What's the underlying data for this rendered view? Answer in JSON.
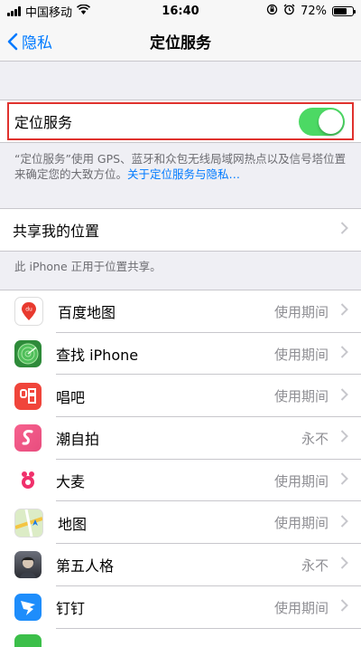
{
  "status": {
    "carrier": "中国移动",
    "time": "16:40",
    "battery": "72%",
    "battery_level": 0.72
  },
  "nav": {
    "back_label": "隐私",
    "title": "定位服务"
  },
  "location_toggle": {
    "label": "定位服务",
    "on": true
  },
  "footer": {
    "text": "“定位服务”使用 GPS、蓝牙和众包无线局域网热点以及信号塔位置来确定您的大致方位。",
    "link": "关于定位服务与隐私…"
  },
  "share": {
    "label": "共享我的位置",
    "note": "此 iPhone 正用于位置共享。"
  },
  "apps": [
    {
      "name": "百度地图",
      "value": "使用期间",
      "icon": "baidu-maps-icon"
    },
    {
      "name": "查找 iPhone",
      "value": "使用期间",
      "icon": "find-iphone-icon"
    },
    {
      "name": "唱吧",
      "value": "使用期间",
      "icon": "changba-icon"
    },
    {
      "name": "潮自拍",
      "value": "永不",
      "icon": "chaozipai-icon"
    },
    {
      "name": "大麦",
      "value": "使用期间",
      "icon": "damai-icon"
    },
    {
      "name": "地图",
      "value": "使用期间",
      "icon": "maps-icon"
    },
    {
      "name": "第五人格",
      "value": "永不",
      "icon": "identity-v-icon"
    },
    {
      "name": "钉钉",
      "value": "使用期间",
      "icon": "dingtalk-icon"
    }
  ],
  "colors": {
    "accent": "#007aff",
    "toggle_on": "#4cd964",
    "highlight": "#e0322e"
  }
}
